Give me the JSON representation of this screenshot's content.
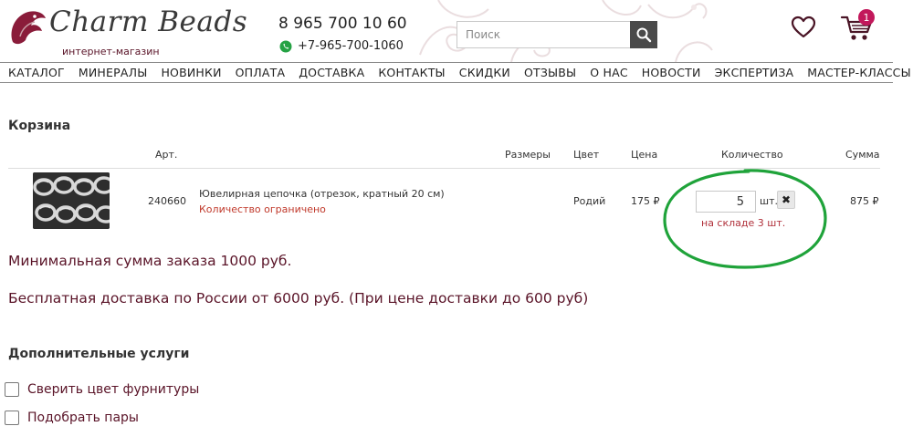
{
  "header": {
    "logo_text": "Charm Beads",
    "logo_subtitle": "интернет-магазин",
    "phone": "8 965 700 10 60",
    "whatsapp": "+7-965-700-1060",
    "search_placeholder": "Поиск",
    "cart_count": "1"
  },
  "nav": {
    "items": [
      "КАТАЛОГ",
      "МИНЕРАЛЫ",
      "НОВИНКИ",
      "ОПЛАТА",
      "ДОСТАВКА",
      "КОНТАКТЫ",
      "СКИДКИ",
      "ОТЗЫВЫ",
      "О НАС",
      "НОВОСТИ",
      "ЭКСПЕРТИЗА",
      "МАСТЕР-КЛАССЫ"
    ]
  },
  "cart": {
    "title": "Корзина",
    "columns": {
      "art": "Арт.",
      "sizes": "Размеры",
      "color": "Цвет",
      "price": "Цена",
      "quantity": "Количество",
      "sum": "Сумма"
    },
    "item": {
      "art": "240660",
      "name": "Ювелирная цепочка (отрезок, кратный 20 см)",
      "limit_note": "Количество ограничено",
      "color": "Родий",
      "price": "175 ₽",
      "quantity": "5",
      "unit": "шт.",
      "remove": "✖",
      "stock": "на складе 3 шт.",
      "sum": "875 ₽"
    }
  },
  "notices": {
    "min_order": "Минимальная сумма заказа 1000 руб.",
    "free_delivery": "Бесплатная доставка по России от 6000 руб. (При цене доставки до 600 руб)"
  },
  "extras": {
    "title": "Дополнительные услуги",
    "options": [
      "Сверить цвет фурнитуры",
      "Подобрать пары"
    ]
  },
  "colors": {
    "accent": "#5a1428",
    "badge": "#c2185b",
    "warning": "#c0392b",
    "highlight_circle": "#1fa33a"
  }
}
